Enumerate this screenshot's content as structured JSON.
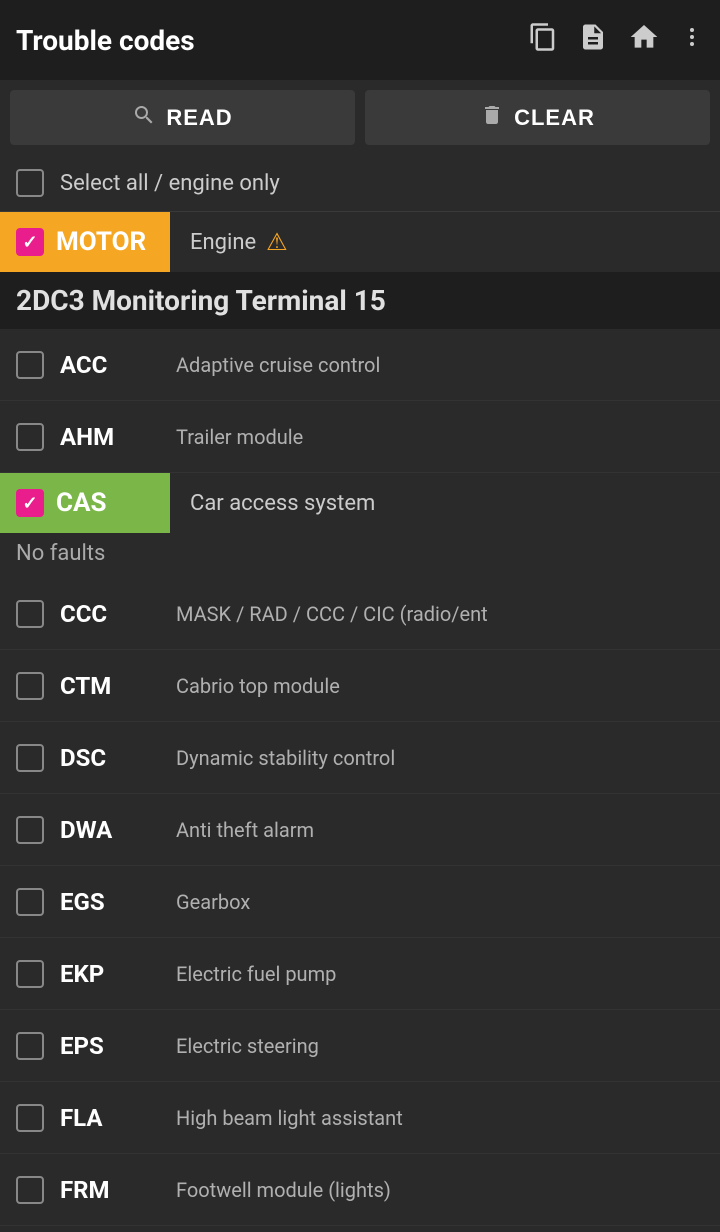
{
  "header": {
    "title": "Trouble codes",
    "icons": [
      "copy",
      "document",
      "home",
      "more-vert"
    ]
  },
  "toolbar": {
    "read_label": "READ",
    "clear_label": "CLEAR"
  },
  "select_all": {
    "label": "Select all / engine only",
    "checked": false
  },
  "motor_module": {
    "code": "MOTOR",
    "description": "Engine",
    "has_warning": true,
    "checked": true
  },
  "section_title": "2DC3 Monitoring Terminal 15",
  "cas_module": {
    "code": "CAS",
    "description": "Car access system",
    "checked": true,
    "status": "No faults"
  },
  "items": [
    {
      "code": "ACC",
      "description": "Adaptive cruise control",
      "checked": false
    },
    {
      "code": "AHM",
      "description": "Trailer module",
      "checked": false
    },
    {
      "code": "CCC",
      "description": "MASK / RAD / CCC / CIC (radio/ent",
      "checked": false
    },
    {
      "code": "CTM",
      "description": "Cabrio top module",
      "checked": false
    },
    {
      "code": "DSC",
      "description": "Dynamic stability control",
      "checked": false
    },
    {
      "code": "DWA",
      "description": "Anti theft alarm",
      "checked": false
    },
    {
      "code": "EGS",
      "description": "Gearbox",
      "checked": false
    },
    {
      "code": "EKP",
      "description": "Electric fuel pump",
      "checked": false
    },
    {
      "code": "EPS",
      "description": "Electric steering",
      "checked": false
    },
    {
      "code": "FLA",
      "description": "High beam light assistant",
      "checked": false
    },
    {
      "code": "FRM",
      "description": "Footwell module (lights)",
      "checked": false
    }
  ]
}
